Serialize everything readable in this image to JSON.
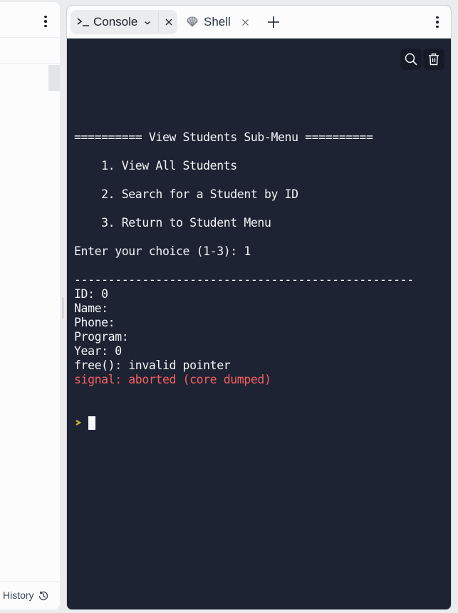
{
  "left_panel": {
    "footer": {
      "history_label": "History",
      "history_icon": "history-icon"
    }
  },
  "tabs": [
    {
      "label": "Console",
      "icon": "console-prompt-icon",
      "active": true,
      "has_dropdown": true
    },
    {
      "label": "Shell",
      "icon": "shell-icon",
      "active": false
    }
  ],
  "terminal": {
    "tools": [
      "search-icon",
      "trash-icon"
    ],
    "lines": [
      {
        "text": "",
        "type": "normal"
      },
      {
        "text": "========== View Students Sub-Menu ==========",
        "type": "normal"
      },
      {
        "text": "",
        "type": "normal"
      },
      {
        "text": "    1. View All Students",
        "type": "normal"
      },
      {
        "text": "",
        "type": "normal"
      },
      {
        "text": "    2. Search for a Student by ID",
        "type": "normal"
      },
      {
        "text": "",
        "type": "normal"
      },
      {
        "text": "    3. Return to Student Menu",
        "type": "normal"
      },
      {
        "text": "",
        "type": "normal"
      },
      {
        "text": "Enter your choice (1-3): 1",
        "type": "normal"
      },
      {
        "text": "",
        "type": "normal"
      },
      {
        "text": "--------------------------------------------------",
        "type": "normal"
      },
      {
        "text": "ID: 0",
        "type": "normal"
      },
      {
        "text": "Name:",
        "type": "normal"
      },
      {
        "text": "Phone:",
        "type": "normal"
      },
      {
        "text": "Program:",
        "type": "normal"
      },
      {
        "text": "Year: 0",
        "type": "normal"
      },
      {
        "text": "free(): invalid pointer",
        "type": "normal"
      },
      {
        "text": "signal: aborted (core dumped)",
        "type": "error"
      }
    ],
    "colors": {
      "background": "#1e2333",
      "text": "#f2f4f8",
      "error": "#f25f62",
      "prompt": "#c9b32e"
    }
  }
}
